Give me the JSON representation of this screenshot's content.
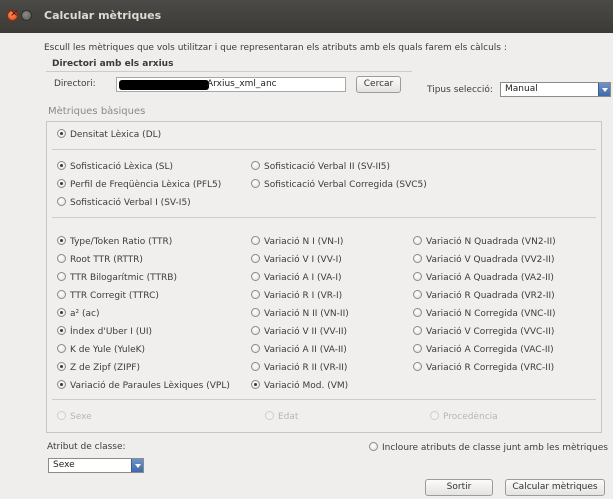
{
  "window": {
    "title": "Calcular mètriques"
  },
  "intro": "Escull les mètriques que vols utilitzar i que representaran els atributs amb els quals farem els càlculs :",
  "dir_section": {
    "title": "Directori amb els arxius",
    "label": "Directori:",
    "value": "Arxius_xml_anc",
    "browse_button": "Cercar"
  },
  "selection_type": {
    "label": "Tipus selecció:",
    "value": "Manual"
  },
  "basic_metrics": {
    "title": "Mètriques bàsiques",
    "group1": [
      {
        "label": "Densitat Lèxica (DL)",
        "checked": true
      }
    ],
    "group2": [
      {
        "label": "Sofisticació Lèxica (SL)",
        "checked": true
      },
      {
        "label": "Perfil de Freqüència Lèxica (PFL5)",
        "checked": true
      },
      {
        "label": "Sofisticació Verbal I (SV-I5)",
        "checked": false
      },
      {
        "label": "Sofisticació Verbal II (SV-II5)",
        "checked": false
      },
      {
        "label": "Sofisticació Verbal Corregida (SVC5)",
        "checked": false
      }
    ],
    "group3": [
      {
        "label": "Type/Token Ratio (TTR)",
        "checked": true
      },
      {
        "label": "Root TTR (RTTR)",
        "checked": false
      },
      {
        "label": "TTR Bilogarítmic (TTRB)",
        "checked": false
      },
      {
        "label": "TTR Corregit (TTRC)",
        "checked": false
      },
      {
        "label": "a² (ac)",
        "checked": true
      },
      {
        "label": "Índex d'Uber I (UI)",
        "checked": true
      },
      {
        "label": "K de Yule (YuleK)",
        "checked": false
      },
      {
        "label": "Z de Zipf (ZIPF)",
        "checked": true
      },
      {
        "label": "Variació de Paraules Lèxiques (VPL)",
        "checked": true
      },
      {
        "label": "Variació N I (VN-I)",
        "checked": false
      },
      {
        "label": "Variació V I (VV-I)",
        "checked": false
      },
      {
        "label": "Variació A I (VA-I)",
        "checked": false
      },
      {
        "label": "Variació R I (VR-I)",
        "checked": false
      },
      {
        "label": "Variació N II (VN-II)",
        "checked": false
      },
      {
        "label": "Variació V II (VV-II)",
        "checked": false
      },
      {
        "label": "Variació A II (VA-II)",
        "checked": false
      },
      {
        "label": "Variació R II (VR-II)",
        "checked": false
      },
      {
        "label": "Variació Mod. (VM)",
        "checked": true
      },
      {
        "label": "Variació N Quadrada (VN2-II)",
        "checked": false
      },
      {
        "label": "Variació V Quadrada (VV2-II)",
        "checked": false
      },
      {
        "label": "Variació A Quadrada (VA2-II)",
        "checked": false
      },
      {
        "label": "Variació R Quadrada (VR2-II)",
        "checked": false
      },
      {
        "label": "Variació N Corregida (VNC-II)",
        "checked": false
      },
      {
        "label": "Variació V Corregida (VVC-II)",
        "checked": false
      },
      {
        "label": "Variació A Corregida (VAC-II)",
        "checked": false
      },
      {
        "label": "Variació R Corregida (VRC-II)",
        "checked": false
      }
    ],
    "disabled": [
      {
        "label": "Sexe"
      },
      {
        "label": "Edat"
      },
      {
        "label": "Procedència"
      }
    ]
  },
  "class_attribute": {
    "label": "Atribut de classe:",
    "value": "Sexe"
  },
  "include_class": {
    "label": "Incloure atributs de classe junt amb les mètriques",
    "checked": false
  },
  "buttons": {
    "exit": "Sortir",
    "calculate": "Calcular mètriques"
  },
  "colors": {
    "titlebar": "#3b3a36",
    "close": "#df4a16",
    "combo_arrow": "#3e6aaa",
    "background": "#efeeec"
  }
}
